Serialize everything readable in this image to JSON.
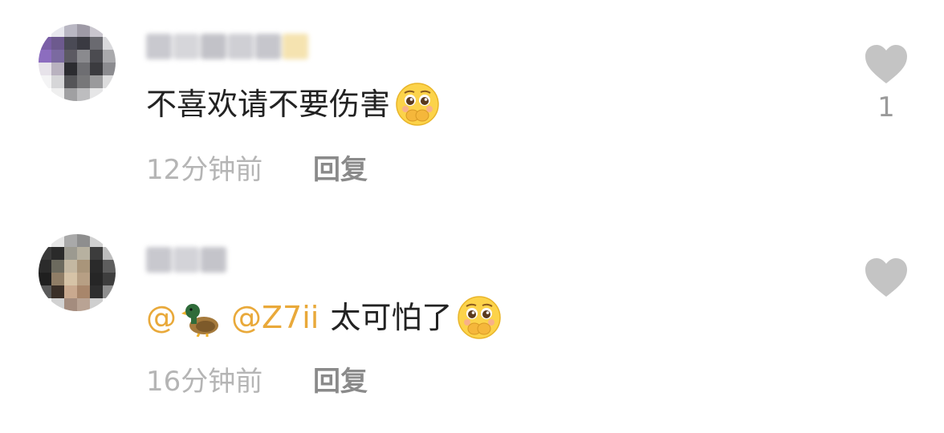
{
  "comments": [
    {
      "username": "",
      "text": "不喜欢请不要伤害",
      "text_emoji": "pleading-face-emoji",
      "time": "12分钟前",
      "reply_label": "回复",
      "like_icon": "heart-icon",
      "like_count": "1"
    },
    {
      "username": "",
      "mention1": "@",
      "mention1_emoji": "duck-emoji",
      "mention2": "@Z7ii",
      "text": "太可怕了",
      "text_emoji": "pleading-face-emoji",
      "time": "16分钟前",
      "reply_label": "回复",
      "like_icon": "heart-icon",
      "like_count": ""
    }
  ],
  "colors": {
    "mention": "#e9a93a",
    "text": "#222222",
    "meta": "#b5b5b5",
    "reply": "#8a8a8a",
    "heart": "#c4c4c4"
  }
}
